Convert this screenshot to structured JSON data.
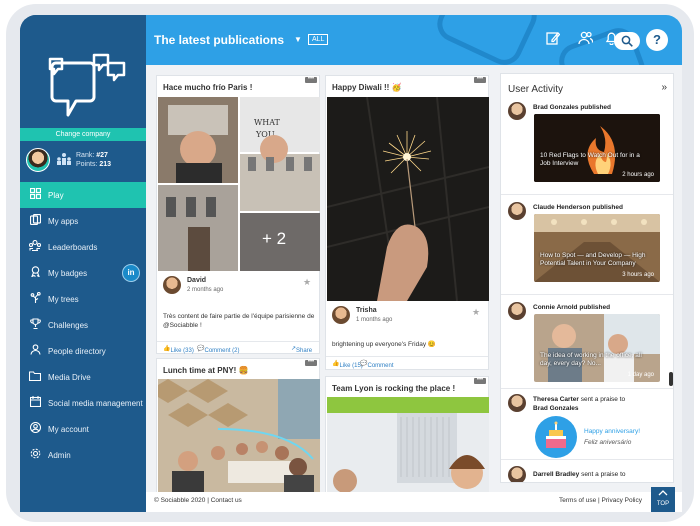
{
  "sidebar": {
    "change_company": "Change company",
    "rank_label": "Rank:",
    "rank_value": "#27",
    "points_label": "Points:",
    "points_value": "213",
    "items": [
      {
        "label": "Play",
        "icon": "grid-icon"
      },
      {
        "label": "My apps",
        "icon": "apps-icon"
      },
      {
        "label": "Leaderboards",
        "icon": "leaderboard-icon"
      },
      {
        "label": "My badges",
        "icon": "badge-icon"
      },
      {
        "label": "My trees",
        "icon": "tree-icon"
      },
      {
        "label": "Challenges",
        "icon": "trophy-icon"
      },
      {
        "label": "People directory",
        "icon": "people-icon"
      },
      {
        "label": "Media Drive",
        "icon": "folder-icon"
      },
      {
        "label": "Social media management",
        "icon": "calendar-icon"
      },
      {
        "label": "My account",
        "icon": "user-icon"
      },
      {
        "label": "Admin",
        "icon": "gear-icon"
      }
    ],
    "linkedin_badge": "in"
  },
  "header": {
    "title": "The latest publications",
    "filter": "ALL"
  },
  "posts": {
    "p1": {
      "title": "Hace mucho frío Paris !",
      "more": "+ 2",
      "author": "David",
      "time": "2 months ago",
      "text_line1": "Très content de faire partie de l'équipe parisienne de",
      "text_line2": "@Sociabble !",
      "like": "Like (33)",
      "comment": "Comment (2)",
      "share": "Share"
    },
    "p2": {
      "title": "Happy Diwali !! 🥳",
      "author": "Trisha",
      "time": "1 months ago",
      "text": "brightening up everyone's Friday 😊",
      "like": "Like (15)",
      "comment": "Comment"
    },
    "p3": {
      "title": "Lunch time at PNY! 🍔"
    },
    "p4": {
      "title": "Team Lyon is rocking the place !"
    }
  },
  "activity": {
    "title": "User Activity",
    "entries": [
      {
        "name": "Brad Gonzales",
        "action": "published",
        "caption": "10 Red Flags to Watch Out for in a Job Interview",
        "ago": "2 hours ago"
      },
      {
        "name": "Claude Henderson",
        "action": "published",
        "caption": "How to Spot — and Develop — High Potential Talent in Your Company",
        "ago": "3 hours ago"
      },
      {
        "name": "Connie Arnold",
        "action": "published",
        "caption": "The idea of working in the office, all day, every day? No...",
        "ago": "1 day ago"
      },
      {
        "name": "Theresa Carter",
        "action": "sent a praise to",
        "target": "Brad Gonzales",
        "praise1": "Happy anniversary!",
        "praise2": "Feliz aniversário"
      },
      {
        "name": "Darrell Bradley",
        "action": "sent a praise to"
      }
    ]
  },
  "footer": {
    "copyright": "© Sociabble 2020",
    "contact": "Contact us",
    "terms": "Terms of use",
    "privacy": "Privacy Policy",
    "top": "TOP"
  },
  "colors": {
    "sidebar": "#1e5a8c",
    "header": "#2ea0e6",
    "accent": "#1fc3b0"
  }
}
